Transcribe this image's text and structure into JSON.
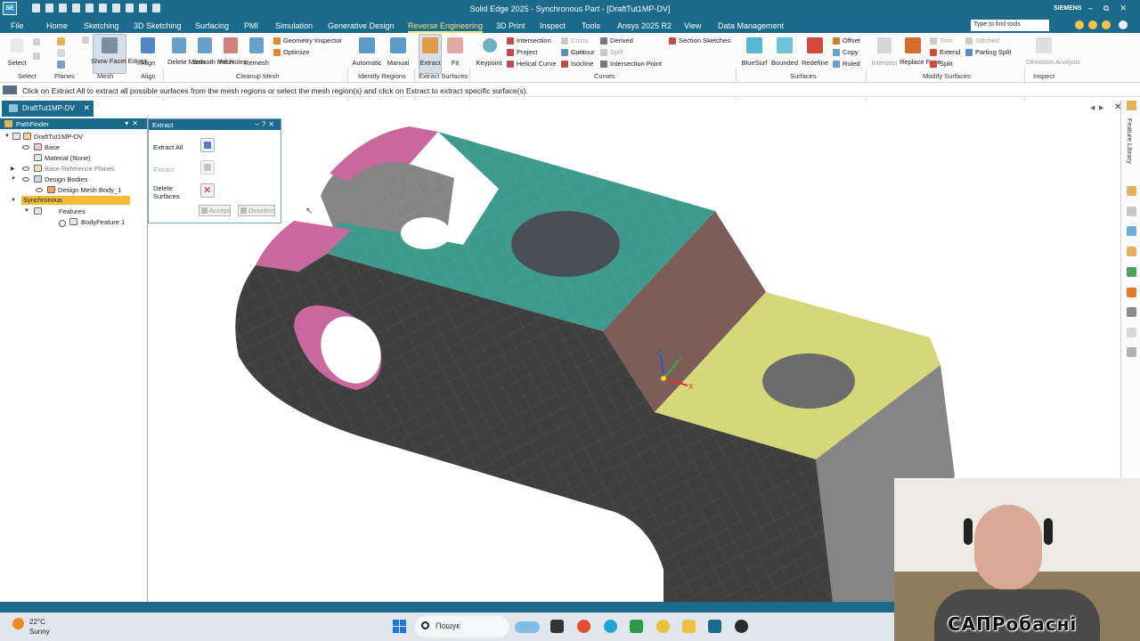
{
  "app": {
    "logo": "SE",
    "title": "Solid Edge 2025 - Synchronous Part - [DraftTut1MP-DV]",
    "brand": "SIEMENS",
    "window_controls": [
      "–",
      "⧉",
      "✕"
    ]
  },
  "menu": {
    "items": [
      "File",
      "Home",
      "Sketching",
      "3D Sketching",
      "Surfacing",
      "PMI",
      "Simulation",
      "Generative Design",
      "Reverse Engineering",
      "3D Print",
      "Inspect",
      "Tools",
      "Ansys 2025 R2",
      "View",
      "Data Management"
    ],
    "active": "Reverse Engineering",
    "search_placeholder": "Type to find tools"
  },
  "ribbon": {
    "buttons": {
      "select": "Select",
      "show_facet_edges": "Show Facet Edges",
      "align": "Align",
      "delete_mesh": "Delete Mesh",
      "smooth_mesh": "Smooth Mesh",
      "fill_holes": "Fill Holes",
      "remesh": "Remesh",
      "geometry_inspector": "Geometry Inspector",
      "optimize": "Optimize",
      "automatic": "Automatic",
      "manual": "Manual",
      "extract": "Extract",
      "fit": "Fit",
      "keypoint": "Keypoint",
      "intersection": "Intersection",
      "project": "Project",
      "helical_curve": "Helical Curve",
      "cross": "Cross",
      "split": "Split",
      "contour": "Contour",
      "isocline": "Isocline",
      "derived": "Derived",
      "intersection_point": "Intersection Point",
      "section_sketches": "Section Sketches",
      "bluesurf": "BlueSurf",
      "bounded": "Bounded",
      "redefine": "Redefine",
      "offset": "Offset",
      "copy": "Copy",
      "ruled": "Ruled",
      "intersect": "Intersect",
      "replace_face": "Replace Face",
      "trim": "Trim",
      "extend": "Extend",
      "split_face": "Split",
      "stitched": "Stitched",
      "parting_split": "Parting Split",
      "deviation_analysis": "Deviation Analysis"
    },
    "groups": [
      "Select",
      "Planes",
      "Mesh",
      "Align",
      "Cleanup Mesh",
      "Identify Regions",
      "Extract Surfaces",
      "Curves",
      "Surfaces",
      "Modify Surfaces",
      "Inspect"
    ]
  },
  "prompt": "Click on Extract All to extract all possible surfaces from the mesh regions or select the mesh region(s) and click on Extract to extract specific surface(s).",
  "doc_tab": "DraftTut1MP-DV",
  "pathfinder": {
    "title": "PathFinder",
    "root": "DraftTut1MP-DV",
    "base": "Base",
    "material": "Material (None)",
    "ref_planes": "Base Reference Planes",
    "design_bodies": "Design Bodies",
    "mesh_body": "Design Mesh Body_1",
    "synchronous": "Synchronous",
    "features": "Features",
    "body_feature": "BodyFeature 1"
  },
  "extract_panel": {
    "title": "Extract",
    "extract_all": "Extract All",
    "extract": "Extract",
    "delete_surfaces_1": "Delete",
    "delete_surfaces_2": "Surfaces",
    "accept": "Accept",
    "deselect": "Deselect"
  },
  "triad": {
    "z": "Z",
    "y": "Y",
    "x": "X"
  },
  "right_sidebar": {
    "label": "Feature Library"
  },
  "taskbar": {
    "temperature": "22°C",
    "weather": "Sunny",
    "search": "Пошук"
  },
  "watermark": "САПРобасні",
  "colors": {
    "title_bar": "#1b6a8c",
    "active_tab": "#f6e37b",
    "synchronous_highlight": "#f2bc3a",
    "face_teal": "#3d9a8c",
    "face_pink": "#c9689d",
    "face_yellow": "#d6d779",
    "face_brown": "#7d5d58",
    "face_gray": "#858585",
    "face_dark": "#3f3f3f"
  }
}
